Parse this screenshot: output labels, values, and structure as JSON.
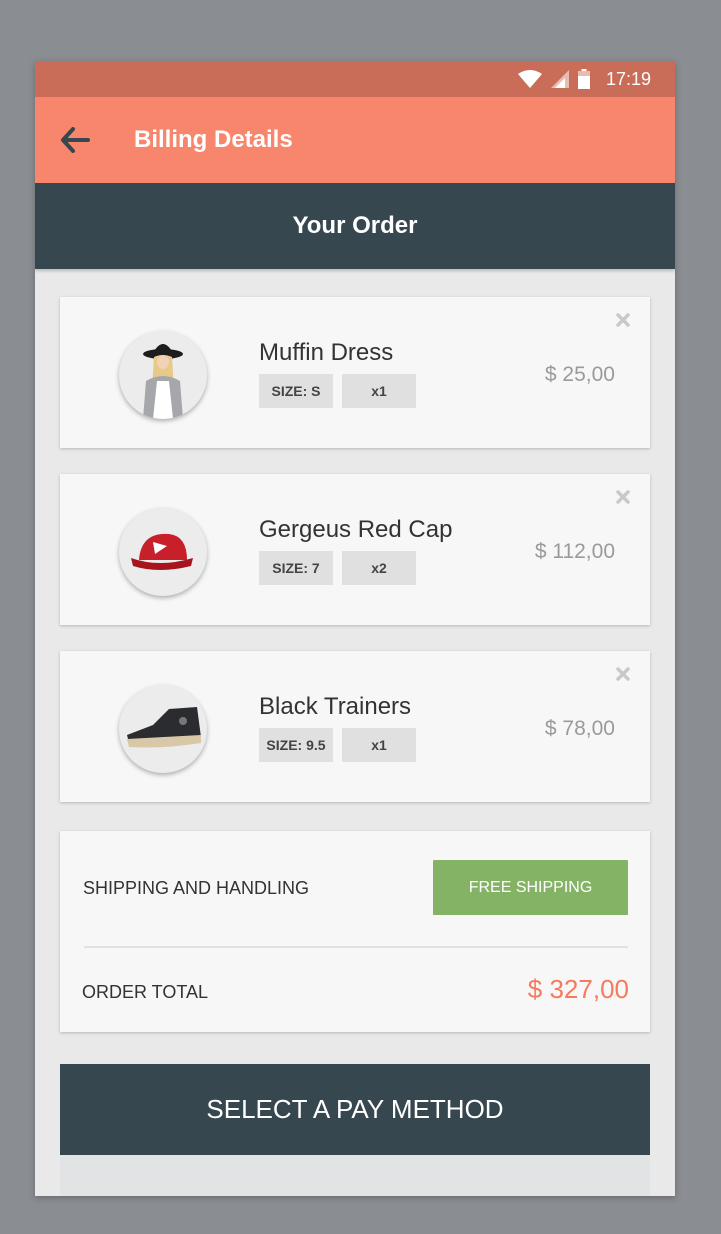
{
  "status_bar": {
    "time": "17:19",
    "icons": [
      "wifi-icon",
      "signal-icon",
      "battery-icon"
    ]
  },
  "app_bar": {
    "title": "Billing Details",
    "back_icon": "arrow-back-icon"
  },
  "order_header": "Your Order",
  "items": [
    {
      "name": "Muffin Dress",
      "size": "SIZE: S",
      "qty": "x1",
      "price": "$ 25,00",
      "image": "dress-icon"
    },
    {
      "name": "Gergeus Red Cap",
      "size": "SIZE: 7",
      "qty": "x2",
      "price": "$ 112,00",
      "image": "cap-icon"
    },
    {
      "name": "Black Trainers",
      "size": "SIZE: 9.5",
      "qty": "x1",
      "price": "$ 78,00",
      "image": "sneaker-icon"
    }
  ],
  "summary": {
    "shipping_label": "SHIPPING AND HANDLING",
    "shipping_button": "FREE SHIPPING",
    "total_label": "ORDER TOTAL",
    "total_value": "$ 327,00"
  },
  "pay_button": "SELECT A PAY METHOD",
  "colors": {
    "app_bar": "#f7866d",
    "status_bar": "#c96d58",
    "dark": "#37474f",
    "free_shipping": "#85b366",
    "total_accent": "#f57a5e"
  }
}
